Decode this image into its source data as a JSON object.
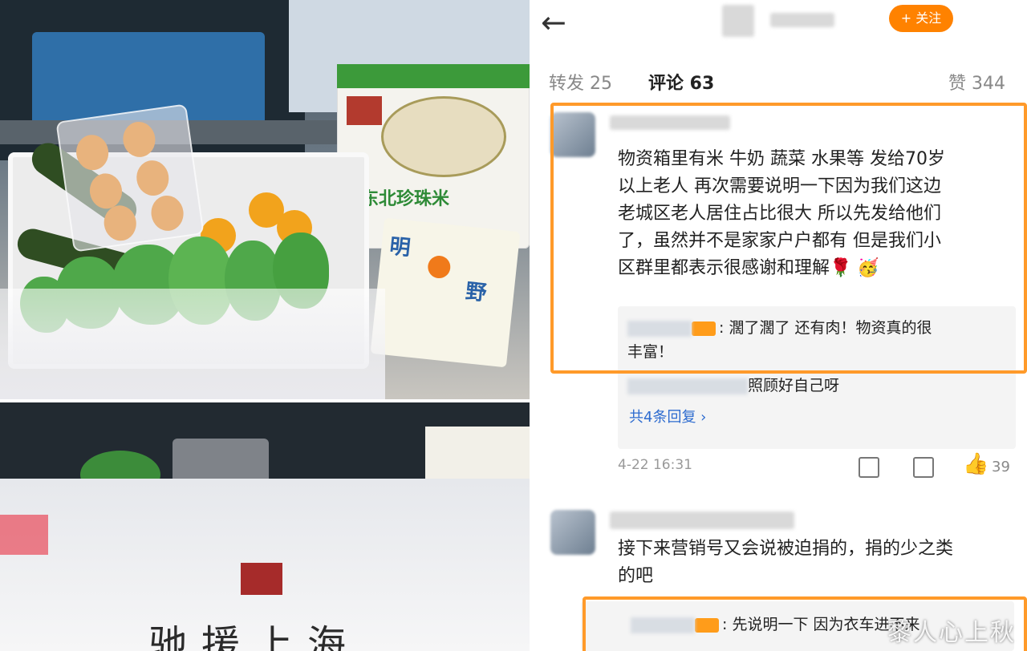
{
  "header": {
    "back_icon": "back-arrow-icon",
    "follow_label": "+ 关注",
    "follow_color": "#ff8200"
  },
  "tabs": {
    "repost": "转发 25",
    "comments": "评论 63",
    "likes": "赞 344"
  },
  "comments": [
    {
      "text_lines": [
        "物资箱里有米 牛奶 蔬菜 水果等 发给70岁",
        "以上老人 再次需要说明一下因为我们这边",
        "老城区老人居住占比很大 所以先发给他们",
        "了，虽然并不是家家户户都有 但是我们小",
        "区群里都表示很感谢和理解🌹 🥳"
      ],
      "reply_1_lines": [
        ": 濶了濶了 还有肉！物资真的很",
        "丰富！"
      ],
      "reply_2": "照顾好自己呀",
      "more_replies": "共4条回复 ›",
      "timestamp": "4-22 16:31",
      "likes": "39"
    },
    {
      "text_lines": [
        "接下来营销号又会说被迫捐的，捐的少之类",
        "的吧"
      ],
      "reply_1": ": 先说明一下 因为衣车进不来"
    }
  ],
  "photo": {
    "rice_name": "东北珍珠米",
    "milk_brand_1": "明",
    "milk_brand_2": "野",
    "bottom_sign": "驰援上海"
  },
  "watermark": "黎人心上秋",
  "colors": {
    "highlight": "#ff9a2a",
    "link": "#2d6bcf"
  }
}
